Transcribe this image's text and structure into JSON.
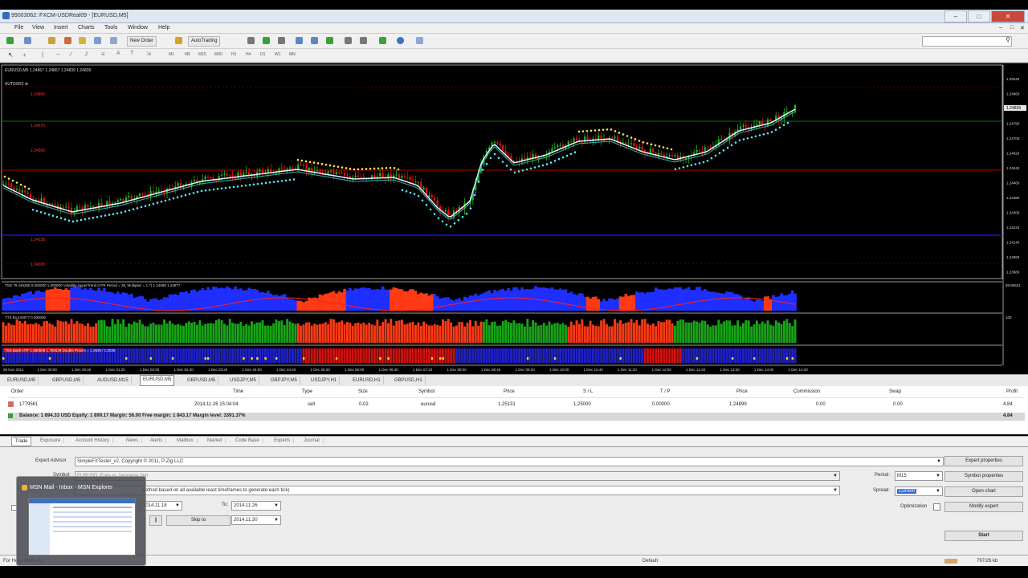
{
  "window": {
    "title": "99003062: FXCM-USDReal09 - [EURUSD,M5]"
  },
  "menu": [
    "File",
    "View",
    "Insert",
    "Charts",
    "Tools",
    "Window",
    "Help"
  ],
  "toolbar": {
    "new_order": "New Order",
    "autotrading": "AutoTrading",
    "timeframes": [
      "M1",
      "M5",
      "M15",
      "M30",
      "H1",
      "H4",
      "D1",
      "W1",
      "MN"
    ]
  },
  "chart": {
    "symbol_label": "EURUSD,M5 1.24867 1.24867 1.24839 1.24839",
    "indicator_label": "AUTOSR2 ⊕",
    "level_labels": [
      "1.24800",
      "1.24670",
      "1.24500",
      "1.24238",
      "1.24030"
    ],
    "price_scale": [
      "1.25040",
      "1.24960",
      "1.24839",
      "1.24790",
      "1.24700",
      "1.24620",
      "1.24540",
      "1.24460",
      "1.24380",
      "1.24300",
      "1.24220",
      "1.24140",
      "1.24060",
      "1.23980"
    ],
    "price_marker": "1.24839",
    "sub1_label": "TSD 79.446265 0.000000 1.000000   Volatility HyperTrend (ATR Period = 38, Multiplier = 1.7) 1.24888 1.24877",
    "sub1_scale": "98.86631",
    "sub2_label": "TTS 83.433677 0.000000",
    "sub2_scale": "100",
    "sub3_label": "TSS Bash  HTF 1.580508 1.768539   Double Proxim = 1.2626 / 1.2026",
    "time_labels": [
      "28 Nov 2014",
      "1 Dec 00:00",
      "1 Dec 00:40",
      "1 Dec 01:20",
      "1 Dec 02:00",
      "1 Dec 02:40",
      "1 Dec 03:20",
      "1 Dec 04:00",
      "1 Dec 04:40",
      "1 Dec 05:20",
      "1 Dec 06:00",
      "1 Dec 06:40",
      "1 Dec 07:20",
      "1 Dec 08:00",
      "1 Dec 08:40",
      "1 Dec 09:20",
      "1 Dec 10:00",
      "1 Dec 10:40",
      "1 Dec 11:20",
      "1 Dec 12:00",
      "1 Dec 12:40",
      "1 Dec 13:20",
      "1 Dec 14:00",
      "1 Dec 14:40"
    ]
  },
  "chart_tabs": [
    "EURUSD,M5",
    "GBPUSD,M5",
    "AUDUSD,M15",
    "EURUSD,M5",
    "GBPUSD,M5",
    "USDJPY,M5",
    "GBPJPY,M5",
    "USDJPY,H1",
    "EURUSD,H1",
    "GBPUSD,H1"
  ],
  "terminal": {
    "columns": [
      "Order",
      "Time",
      "Type",
      "Size",
      "Symbol",
      "Price",
      "S / L",
      "T / P",
      "Price",
      "Commission",
      "Swap",
      "Profit"
    ],
    "rows": [
      {
        "order": "1779561",
        "time": "2014.11.26 15:04:04",
        "type": "sell",
        "size": "0.02",
        "symbol": "eurusd",
        "price": "1.25131",
        "sl": "1.25000",
        "tp": "0.00000",
        "price2": "1.24899",
        "commission": "0.00",
        "swap": "0.00",
        "profit": "4.84"
      }
    ],
    "balance_line": "Balance: 1 894.33 USD  Equity: 1 899.17  Margin: 56.00  Free margin: 1 843.17  Margin level: 3391.37%",
    "balance_profit": "4.84"
  },
  "terminal_tabs": [
    "Trade",
    "Exposure",
    "Account History",
    "News",
    "Alerts",
    "Mailbox",
    "Market",
    "Code Base",
    "Experts",
    "Journal"
  ],
  "tester": {
    "expert_label": "Expert Advisor",
    "expert_value": "SimpleFXTester_v2, Copyright © 2011, P-Zig LLC",
    "symbol_label": "Symbol:",
    "symbol_value": "EURUSD, Euro vs Japanese Yen",
    "model_value": "method based on all available least timeframes to generate each tick)",
    "from_date": "2014.11.18",
    "to_label": "To:",
    "to_date": "2014.11.26",
    "skip_to": "Skip to",
    "skip_date": "2014.11.30",
    "period_label": "Period:",
    "period_value": "M15",
    "spread_label": "Spread:",
    "spread_value": "Current",
    "optimization_label": "Optimization",
    "buttons": {
      "expert_properties": "Expert properties",
      "symbol_properties": "Symbol properties",
      "open_chart": "Open chart",
      "modify_expert": "Modify expert",
      "start": "Start"
    }
  },
  "popup": {
    "title": "MSN Mail - Inbox - MSN Explorer"
  },
  "status": {
    "left": "For Help, press F1",
    "profile": "Default",
    "traffic": "797/26 kb"
  },
  "colors": {
    "ema_line": "#e8f0ff",
    "dots_up": "#55e8ff",
    "dots_down": "#ffe64a",
    "bull": "#1fb41f",
    "bear": "#e01414",
    "level_green": "#0c6e0c",
    "level_red": "#b00000",
    "level_blue": "#1010a0",
    "hist_blue": "#1f2fff",
    "hist_red": "#ff3a14",
    "hist_green": "#16a516"
  }
}
